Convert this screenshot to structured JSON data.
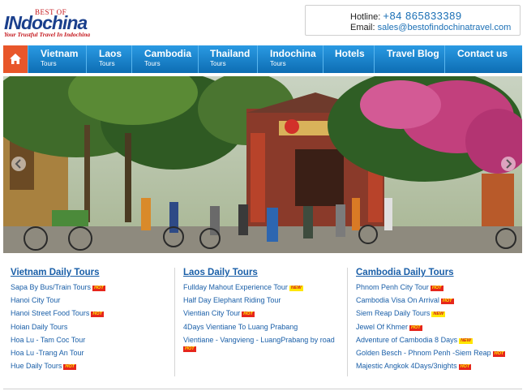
{
  "logo": {
    "best_of": "BEST OF",
    "brand_in": "IN",
    "brand_rest": "dochina",
    "tagline": "Your Trustful Travel In Indochina"
  },
  "contact": {
    "hotline_label": "Hotline:",
    "hotline_value": "+84 865833389",
    "email_label": "Email:",
    "email_value": "sales@bestofindochinatravel.com"
  },
  "nav": {
    "home_icon": "home-icon",
    "items": [
      {
        "label": "Vietnam",
        "sub": "Tours"
      },
      {
        "label": "Laos",
        "sub": "Tours"
      },
      {
        "label": "Cambodia",
        "sub": "Tours"
      },
      {
        "label": "Thailand",
        "sub": "Tours"
      },
      {
        "label": "Indochina",
        "sub": "Tours"
      },
      {
        "label": "Hotels",
        "sub": ""
      },
      {
        "label": "Travel Blog",
        "sub": ""
      },
      {
        "label": "Contact us",
        "sub": ""
      }
    ]
  },
  "hero": {
    "prev_icon": "chevron-left-icon",
    "next_icon": "chevron-right-icon"
  },
  "badges": {
    "hot": "HOT",
    "new": "NEW"
  },
  "columns": [
    {
      "heading": "Vietnam Daily Tours",
      "items": [
        {
          "label": "Sapa By Bus/Train Tours",
          "badge": "hot"
        },
        {
          "label": "Hanoi City Tour",
          "badge": ""
        },
        {
          "label": "Hanoi Street Food Tours",
          "badge": "hot"
        },
        {
          "label": "Hoian Daily Tours",
          "badge": ""
        },
        {
          "label": "Hoa Lu - Tam Coc Tour",
          "badge": ""
        },
        {
          "label": "Hoa Lu -Trang An Tour",
          "badge": ""
        },
        {
          "label": "Hue Daily Tours",
          "badge": "hot"
        }
      ]
    },
    {
      "heading": "Laos Daily Tours",
      "items": [
        {
          "label": "Fullday Mahout Experience Tour",
          "badge": "new"
        },
        {
          "label": "Half Day Elephant Riding Tour",
          "badge": ""
        },
        {
          "label": "Vientian City Tour",
          "badge": "hot"
        },
        {
          "label": "4Days Vientiane To Luang Prabang",
          "badge": ""
        },
        {
          "label": "Vientiane - Vangvieng - LuangPrabang by road",
          "badge": "hot"
        }
      ]
    },
    {
      "heading": "Cambodia Daily Tours",
      "items": [
        {
          "label": "Phnom Penh City Tour",
          "badge": "hot"
        },
        {
          "label": "Cambodia Visa On Arrival",
          "badge": "hot"
        },
        {
          "label": "Siem Reap Daily Tours",
          "badge": "new"
        },
        {
          "label": "Jewel Of Khmer",
          "badge": "hot"
        },
        {
          "label": "Adventure of Cambodia 8 Days",
          "badge": "new"
        },
        {
          "label": "Golden Besch - Phnom Penh -Siem Reap",
          "badge": "hot"
        },
        {
          "label": "Majestic Angkok 4Days/3nights",
          "badge": "hot"
        }
      ]
    }
  ]
}
